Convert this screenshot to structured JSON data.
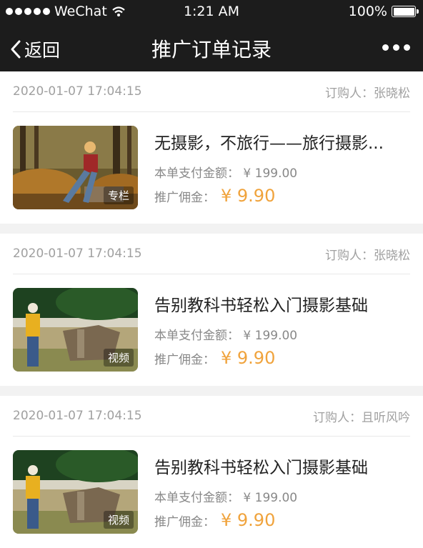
{
  "status_bar": {
    "carrier": "WeChat",
    "time": "1:21 AM",
    "battery": "100%"
  },
  "nav": {
    "back_label": "返回",
    "title": "推广订单记录"
  },
  "orders": [
    {
      "date": "2020-01-07 17:04:15",
      "buyer": "订购人：张晓松",
      "title": "无摄影，不旅行——旅行摄影...",
      "tag": "专栏",
      "pay": "本单支付金额：  ¥ 199.00",
      "commission_label": "推广佣金：",
      "commission": "¥ 9.90",
      "thumb_icon": "forest-photographer-thumbnail"
    },
    {
      "date": "2020-01-07 17:04:15",
      "buyer": "订购人：张晓松",
      "title": "告别教科书轻松入门摄影基础",
      "tag": "视频",
      "pay": "本单支付金额：  ¥ 199.00",
      "commission_label": "推广佣金：",
      "commission": "¥ 9.90",
      "thumb_icon": "park-hiker-thumbnail"
    },
    {
      "date": "2020-01-07 17:04:15",
      "buyer": "订购人：且听风吟",
      "title": "告别教科书轻松入门摄影基础",
      "tag": "视频",
      "pay": "本单支付金额：  ¥ 199.00",
      "commission_label": "推广佣金：",
      "commission": "¥ 9.90",
      "thumb_icon": "park-hiker-thumbnail"
    }
  ],
  "colors": {
    "nav_bg": "#1c1c1c",
    "commission": "#f0a33c"
  }
}
